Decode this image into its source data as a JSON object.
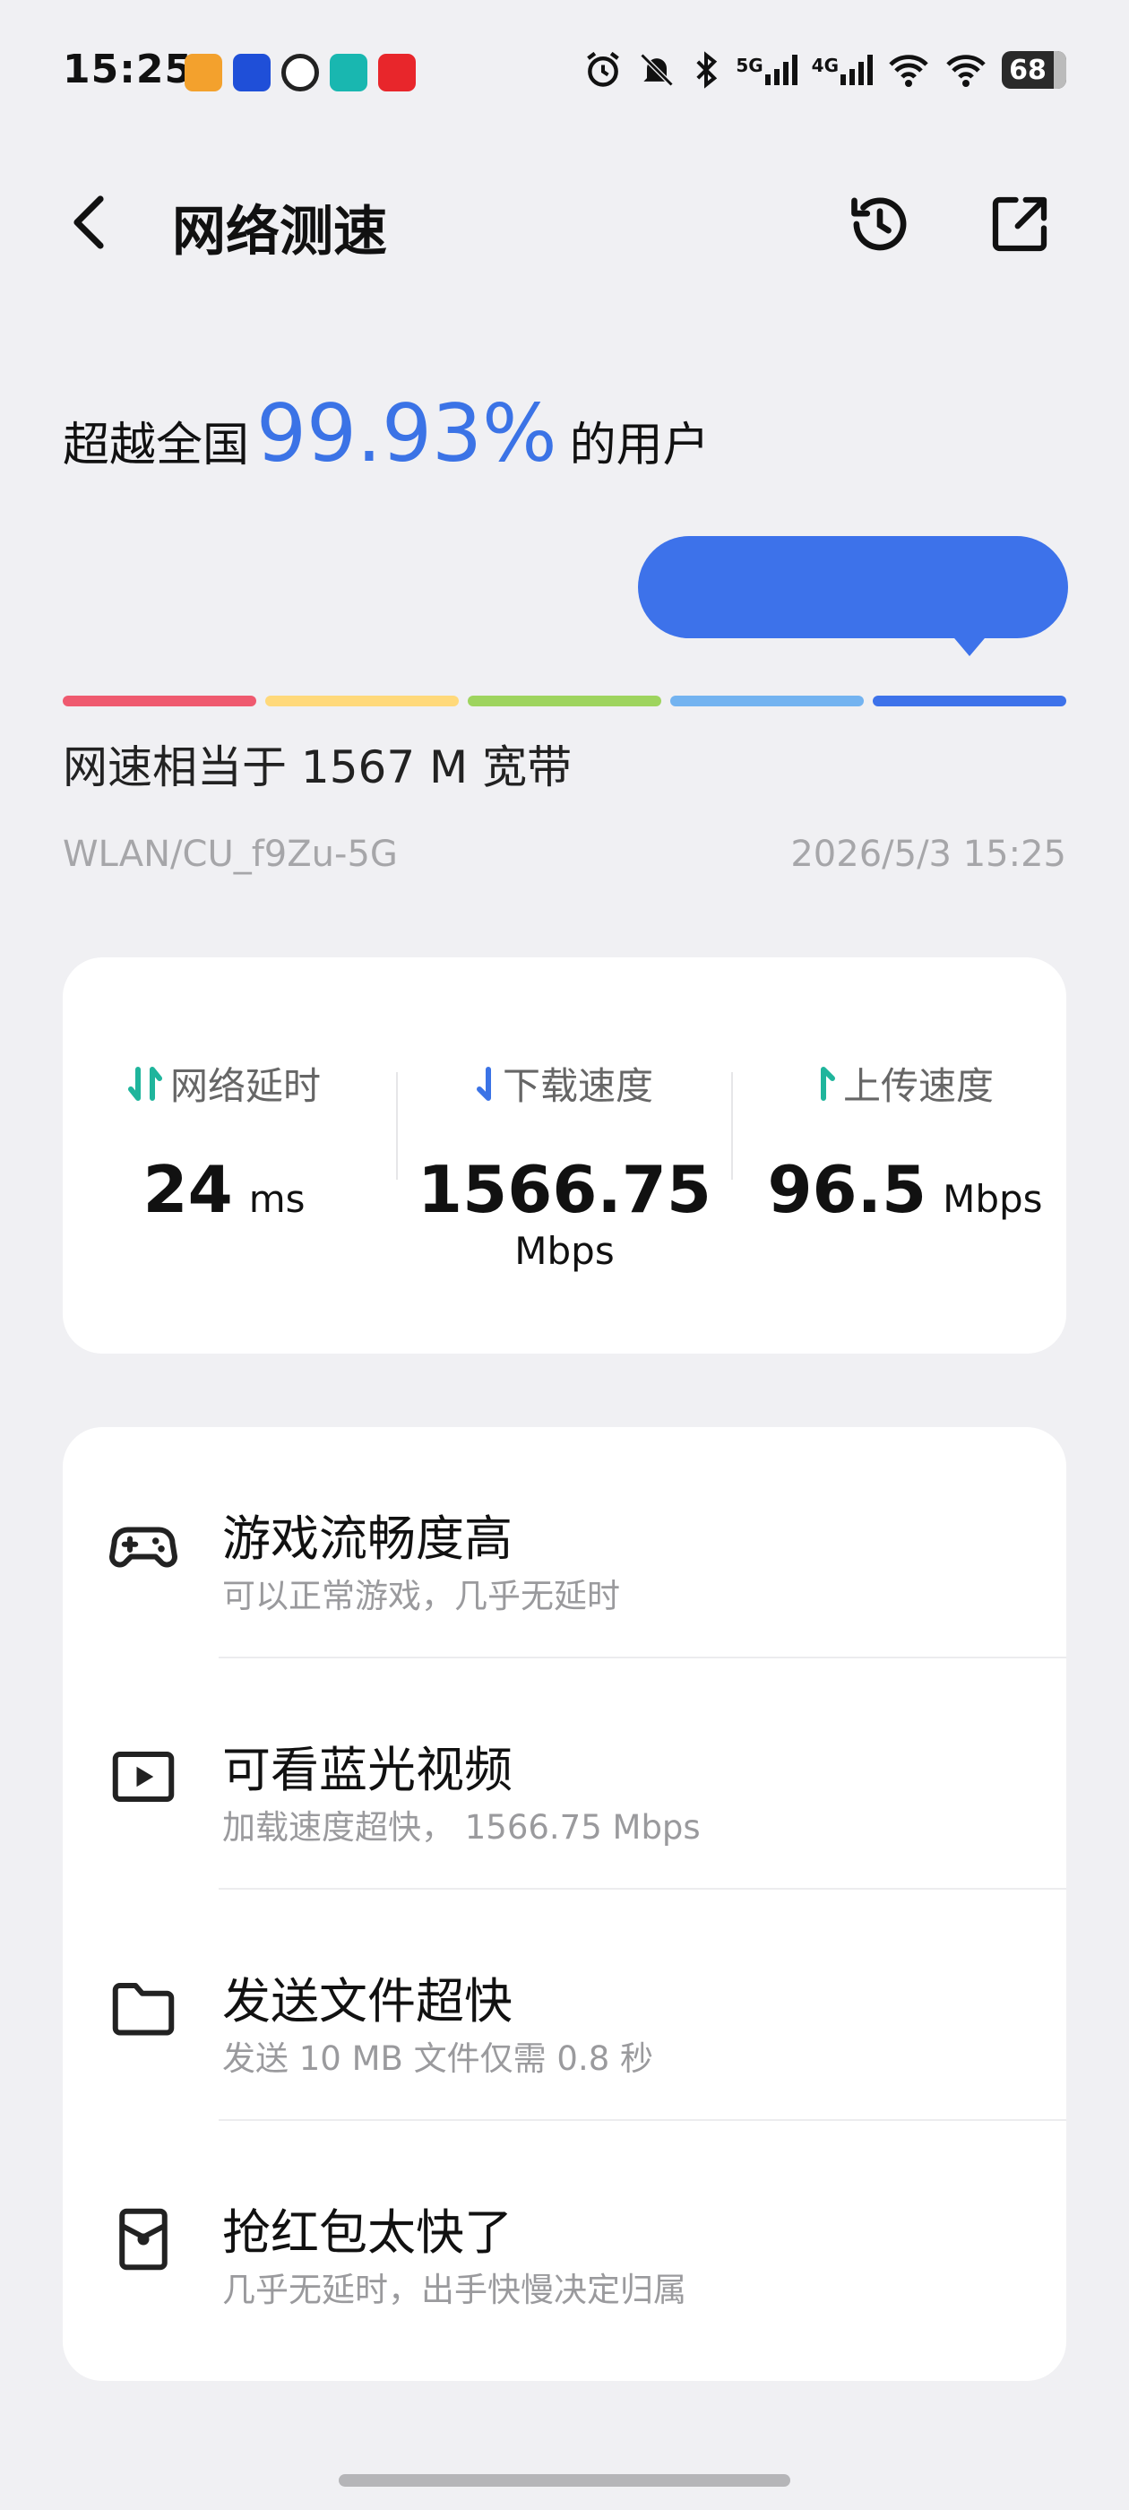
{
  "status_bar": {
    "time": "15:25",
    "battery": "68",
    "signal_5g": "5G",
    "signal_4g": "4G",
    "app_icon_colors": [
      "#f3a12d",
      "#1f4fd8",
      "#222222",
      "#19b7b0",
      "#e8262b"
    ]
  },
  "header": {
    "title": "网络测速"
  },
  "rank": {
    "prefix": "超越全国",
    "percent": "99.93%",
    "suffix": "的用户"
  },
  "speed_scale": {
    "segments": [
      "#ef5a6f",
      "#ffd97a",
      "#9ed45e",
      "#73b3f0",
      "#3d72ea"
    ]
  },
  "result": {
    "equivalent": "网速相当于 1567 M 宽带",
    "network": "WLAN/CU_f9Zu-5G",
    "timestamp": "2026/5/3 15:25"
  },
  "metrics": {
    "latency": {
      "label": "网络延时",
      "value": "24",
      "unit": "ms"
    },
    "download": {
      "label": "下载速度",
      "value": "1566.75",
      "unit": "Mbps"
    },
    "upload": {
      "label": "上传速度",
      "value": "96.5",
      "unit": "Mbps"
    }
  },
  "features": [
    {
      "title": "游戏流畅度高",
      "desc": "可以正常游戏，几乎无延时",
      "icon": "gamepad-icon"
    },
    {
      "title": "可看蓝光视频",
      "desc": "加载速度超快， 1566.75 Mbps",
      "icon": "video-play-icon"
    },
    {
      "title": "发送文件超快",
      "desc": "发送 10 MB 文件仅需 0.8 秒",
      "icon": "folder-icon"
    },
    {
      "title": "抢红包太快了",
      "desc": "几乎无延时，出手快慢决定归属",
      "icon": "red-packet-icon"
    }
  ],
  "colors": {
    "accent": "#3b73e6",
    "teal": "#1fb59c",
    "background": "#f0f0f3"
  }
}
